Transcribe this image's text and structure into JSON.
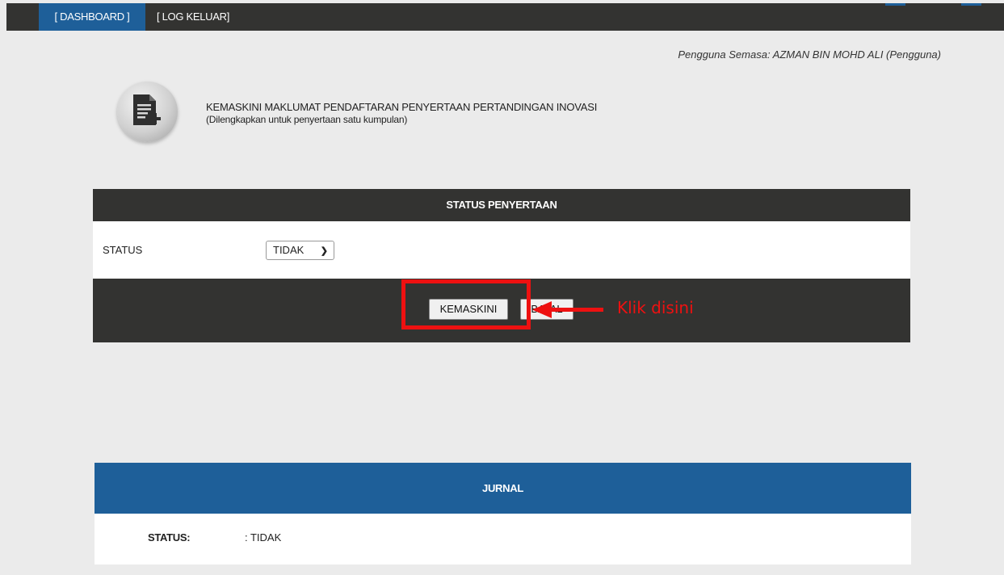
{
  "nav": {
    "dashboard": "[ DASHBOARD ]",
    "logout": "[ LOG KELUAR]"
  },
  "user": {
    "current": "Pengguna Semasa: AZMAN BIN MOHD ALI  (Pengguna)"
  },
  "header": {
    "title": "KEMASKINI MAKLUMAT PENDAFTARAN PENYERTAAN PERTANDINGAN INOVASI",
    "subtitle": "(Dilengkapkan untuk penyertaan satu kumpulan)",
    "icon": "document-add-icon"
  },
  "status_panel": {
    "heading": "STATUS PENYERTAAN",
    "status_label": "STATUS",
    "status_value": "TIDAK",
    "update_button": "KEMASKINI",
    "cancel_button": "BATAL"
  },
  "annotation": {
    "text": "Klik disini",
    "color": "#ee1111"
  },
  "journal": {
    "heading": "JURNAL",
    "status_label": "STATUS:",
    "status_value": ": TIDAK"
  },
  "colors": {
    "dark": "#333331",
    "blue": "#1e5f99",
    "background": "#ebebeb"
  }
}
